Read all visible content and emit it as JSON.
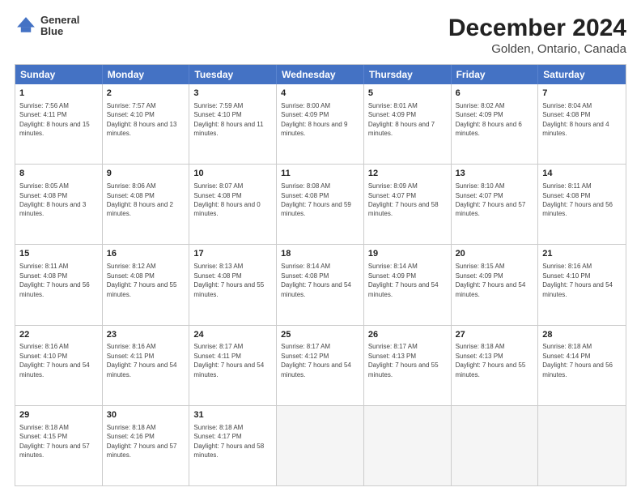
{
  "header": {
    "logo_line1": "General",
    "logo_line2": "Blue",
    "title": "December 2024",
    "subtitle": "Golden, Ontario, Canada"
  },
  "days": [
    "Sunday",
    "Monday",
    "Tuesday",
    "Wednesday",
    "Thursday",
    "Friday",
    "Saturday"
  ],
  "weeks": [
    [
      {
        "day": "1",
        "sunrise": "7:56 AM",
        "sunset": "4:11 PM",
        "daylight": "8 hours and 15 minutes."
      },
      {
        "day": "2",
        "sunrise": "7:57 AM",
        "sunset": "4:10 PM",
        "daylight": "8 hours and 13 minutes."
      },
      {
        "day": "3",
        "sunrise": "7:59 AM",
        "sunset": "4:10 PM",
        "daylight": "8 hours and 11 minutes."
      },
      {
        "day": "4",
        "sunrise": "8:00 AM",
        "sunset": "4:09 PM",
        "daylight": "8 hours and 9 minutes."
      },
      {
        "day": "5",
        "sunrise": "8:01 AM",
        "sunset": "4:09 PM",
        "daylight": "8 hours and 7 minutes."
      },
      {
        "day": "6",
        "sunrise": "8:02 AM",
        "sunset": "4:09 PM",
        "daylight": "8 hours and 6 minutes."
      },
      {
        "day": "7",
        "sunrise": "8:04 AM",
        "sunset": "4:08 PM",
        "daylight": "8 hours and 4 minutes."
      }
    ],
    [
      {
        "day": "8",
        "sunrise": "8:05 AM",
        "sunset": "4:08 PM",
        "daylight": "8 hours and 3 minutes."
      },
      {
        "day": "9",
        "sunrise": "8:06 AM",
        "sunset": "4:08 PM",
        "daylight": "8 hours and 2 minutes."
      },
      {
        "day": "10",
        "sunrise": "8:07 AM",
        "sunset": "4:08 PM",
        "daylight": "8 hours and 0 minutes."
      },
      {
        "day": "11",
        "sunrise": "8:08 AM",
        "sunset": "4:08 PM",
        "daylight": "7 hours and 59 minutes."
      },
      {
        "day": "12",
        "sunrise": "8:09 AM",
        "sunset": "4:07 PM",
        "daylight": "7 hours and 58 minutes."
      },
      {
        "day": "13",
        "sunrise": "8:10 AM",
        "sunset": "4:07 PM",
        "daylight": "7 hours and 57 minutes."
      },
      {
        "day": "14",
        "sunrise": "8:11 AM",
        "sunset": "4:08 PM",
        "daylight": "7 hours and 56 minutes."
      }
    ],
    [
      {
        "day": "15",
        "sunrise": "8:11 AM",
        "sunset": "4:08 PM",
        "daylight": "7 hours and 56 minutes."
      },
      {
        "day": "16",
        "sunrise": "8:12 AM",
        "sunset": "4:08 PM",
        "daylight": "7 hours and 55 minutes."
      },
      {
        "day": "17",
        "sunrise": "8:13 AM",
        "sunset": "4:08 PM",
        "daylight": "7 hours and 55 minutes."
      },
      {
        "day": "18",
        "sunrise": "8:14 AM",
        "sunset": "4:08 PM",
        "daylight": "7 hours and 54 minutes."
      },
      {
        "day": "19",
        "sunrise": "8:14 AM",
        "sunset": "4:09 PM",
        "daylight": "7 hours and 54 minutes."
      },
      {
        "day": "20",
        "sunrise": "8:15 AM",
        "sunset": "4:09 PM",
        "daylight": "7 hours and 54 minutes."
      },
      {
        "day": "21",
        "sunrise": "8:16 AM",
        "sunset": "4:10 PM",
        "daylight": "7 hours and 54 minutes."
      }
    ],
    [
      {
        "day": "22",
        "sunrise": "8:16 AM",
        "sunset": "4:10 PM",
        "daylight": "7 hours and 54 minutes."
      },
      {
        "day": "23",
        "sunrise": "8:16 AM",
        "sunset": "4:11 PM",
        "daylight": "7 hours and 54 minutes."
      },
      {
        "day": "24",
        "sunrise": "8:17 AM",
        "sunset": "4:11 PM",
        "daylight": "7 hours and 54 minutes."
      },
      {
        "day": "25",
        "sunrise": "8:17 AM",
        "sunset": "4:12 PM",
        "daylight": "7 hours and 54 minutes."
      },
      {
        "day": "26",
        "sunrise": "8:17 AM",
        "sunset": "4:13 PM",
        "daylight": "7 hours and 55 minutes."
      },
      {
        "day": "27",
        "sunrise": "8:18 AM",
        "sunset": "4:13 PM",
        "daylight": "7 hours and 55 minutes."
      },
      {
        "day": "28",
        "sunrise": "8:18 AM",
        "sunset": "4:14 PM",
        "daylight": "7 hours and 56 minutes."
      }
    ],
    [
      {
        "day": "29",
        "sunrise": "8:18 AM",
        "sunset": "4:15 PM",
        "daylight": "7 hours and 57 minutes."
      },
      {
        "day": "30",
        "sunrise": "8:18 AM",
        "sunset": "4:16 PM",
        "daylight": "7 hours and 57 minutes."
      },
      {
        "day": "31",
        "sunrise": "8:18 AM",
        "sunset": "4:17 PM",
        "daylight": "7 hours and 58 minutes."
      },
      null,
      null,
      null,
      null
    ]
  ]
}
